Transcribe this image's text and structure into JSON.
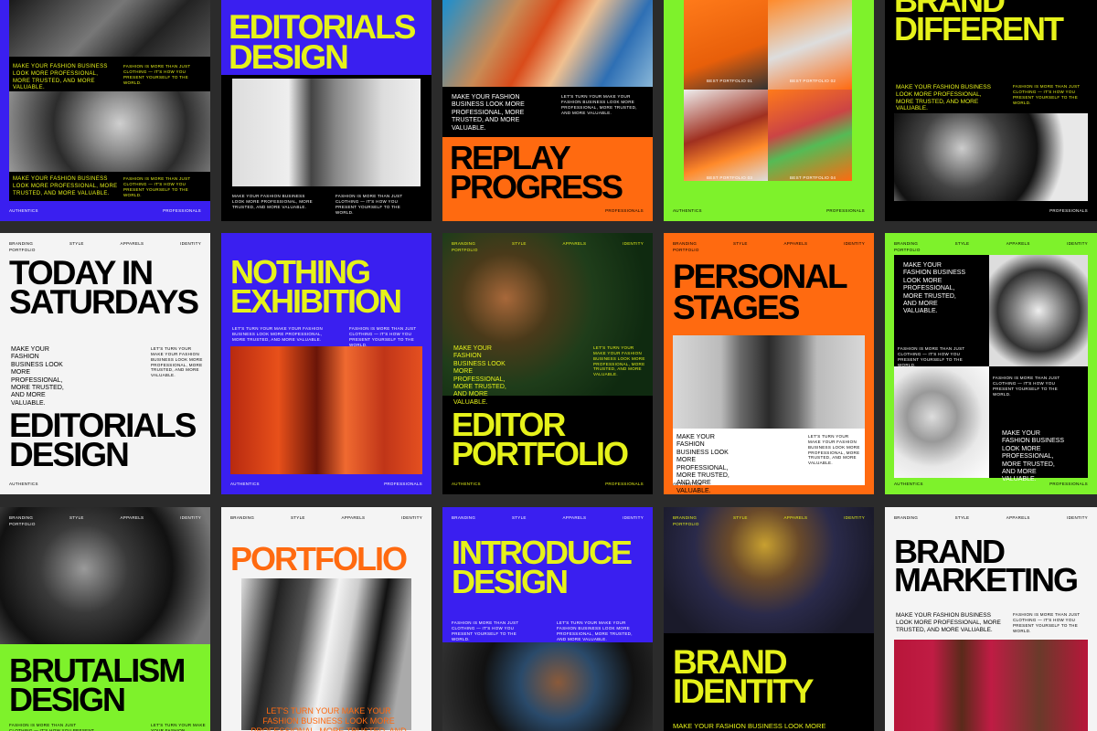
{
  "meta": [
    "BRANDING",
    "STYLE",
    "APPARELS",
    "IDENTITY"
  ],
  "meta_sub": "PORTFOLIO",
  "footer": [
    "AUTHENTICS",
    "PROFESSIONALS"
  ],
  "tagline": "MAKE YOUR FASHION BUSINESS LOOK MORE PROFESSIONAL, MORE TRUSTED, AND MORE VALUABLE.",
  "tagline_stack": "MAKE YOUR FASHION BUSINESS LOOK MORE PROFESSIONAL, MORE TRUSTED, AND MORE VALUABLE.",
  "small_text": "FASHION IS MORE THAN JUST CLOTHING — IT'S HOW YOU PRESENT YOURSELF TO THE WORLD.",
  "small_text2": "LET'S TURN YOUR MAKE YOUR FASHION BUSINESS LOOK MORE PROFESSIONAL, MORE TRUSTED, AND MORE VALUABLE.",
  "cards": {
    "r1c2": {
      "title1": "EDITORIALS",
      "title2": "DESIGN"
    },
    "r1c3": {
      "title1": "REPLAY",
      "title2": "PROGRESS"
    },
    "r1c4": {
      "labels": [
        "BEST PORTFOLIO 01",
        "BEST PORTFOLIO 02",
        "BEST PORTFOLIO 03",
        "BEST PORTFOLIO 04"
      ]
    },
    "r1c5": {
      "title1": "BRAND",
      "title2": "DIFFERENT"
    },
    "r2c1": {
      "title1": "TODAY IN",
      "title2": "SATURDAYS",
      "title3": "EDITORIALS",
      "title4": "DESIGN"
    },
    "r2c2": {
      "title1": "NOTHING",
      "title2": "EXHIBITION"
    },
    "r2c3": {
      "title1": "EDITOR",
      "title2": "PORTFOLIO"
    },
    "r2c4": {
      "title1": "PERSONAL",
      "title2": "STAGES"
    },
    "r3c1": {
      "title1": "BRUTALISM",
      "title2": "DESIGN"
    },
    "r3c2": {
      "title1": "PORTFOLIO",
      "body": "LET'S TURN YOUR MAKE YOUR FASHION BUSINESS LOOK MORE PROFESSIONAL, MORE TRUSTED, AND MORE VALUABLE."
    },
    "r3c3": {
      "title1": "INTRODUCE",
      "title2": "DESIGN"
    },
    "r3c4": {
      "title1": "BRAND",
      "title2": "IDENTITY",
      "body": "MAKE YOUR FASHION BUSINESS LOOK MORE"
    },
    "r3c5": {
      "title1": "BRAND",
      "title2": "MARKETING"
    }
  },
  "colors": {
    "blue": "#3a1ff0",
    "yellow": "#e6f21a",
    "orange": "#ff6a10",
    "green": "#7ef22b",
    "black": "#000000",
    "white": "#f4f4f4"
  }
}
